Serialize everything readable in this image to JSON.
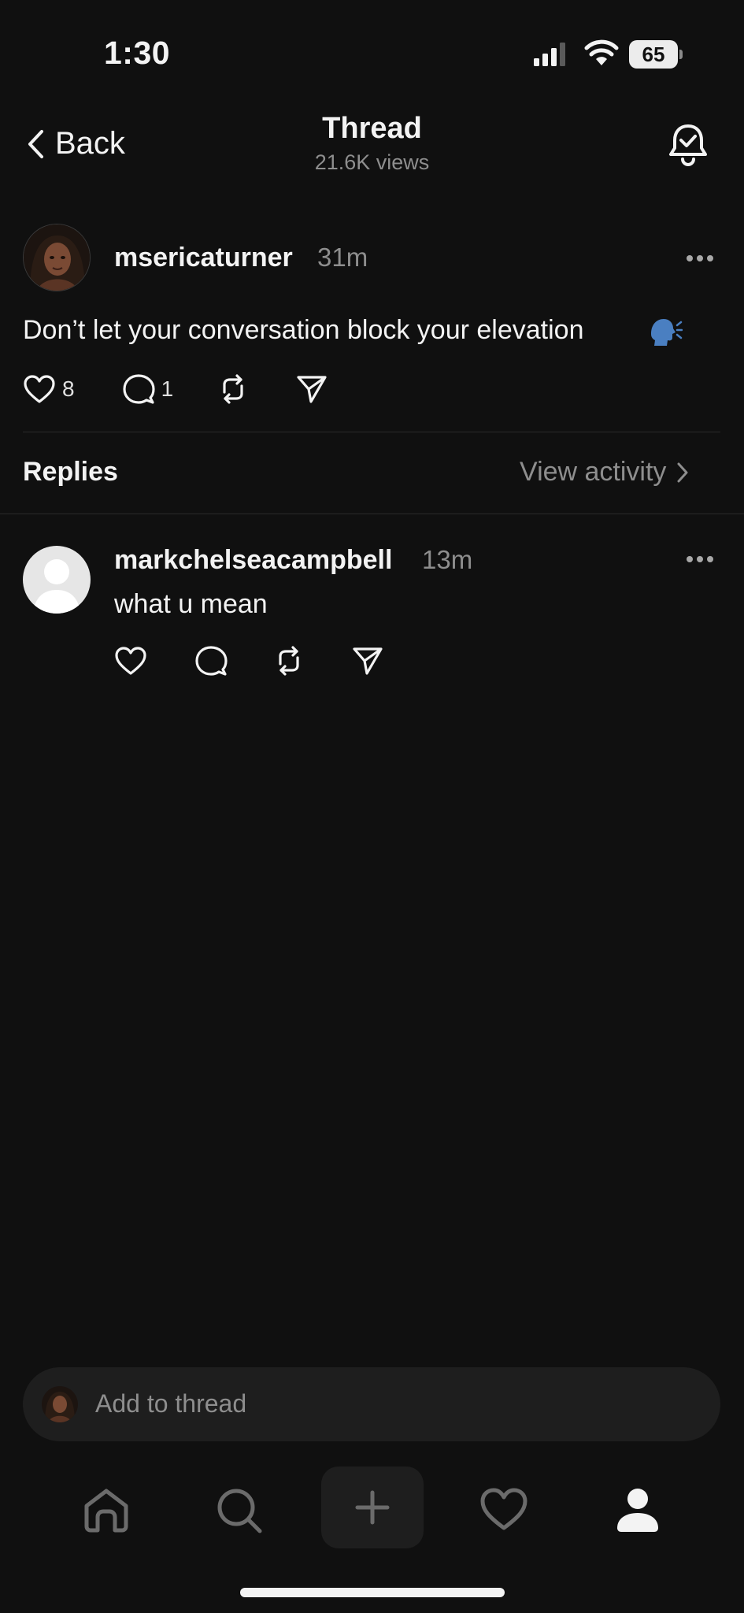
{
  "status_bar": {
    "time": "1:30",
    "battery": "65"
  },
  "header": {
    "back_label": "Back",
    "title": "Thread",
    "views": "21.6K views"
  },
  "post": {
    "username": "msericaturner",
    "time": "31m",
    "text": "Don’t let your conversation block your elevation",
    "emoji": "speaking-head",
    "likes": "8",
    "comments": "1"
  },
  "replies_section": {
    "title": "Replies",
    "view_activity": "View activity"
  },
  "reply": {
    "username": "markchelseacampbell",
    "time": "13m",
    "text": "what u mean"
  },
  "composer": {
    "placeholder": "Add to thread"
  },
  "tab_bar": {
    "icons": [
      "home-icon",
      "search-icon",
      "plus-icon",
      "heart-icon",
      "profile-icon"
    ]
  },
  "colors": {
    "background": "#101010",
    "text": "#f3f3f3",
    "muted": "#8e8e8e",
    "surface": "#1e1e1e",
    "emoji_blue": "#4a7fc1"
  }
}
